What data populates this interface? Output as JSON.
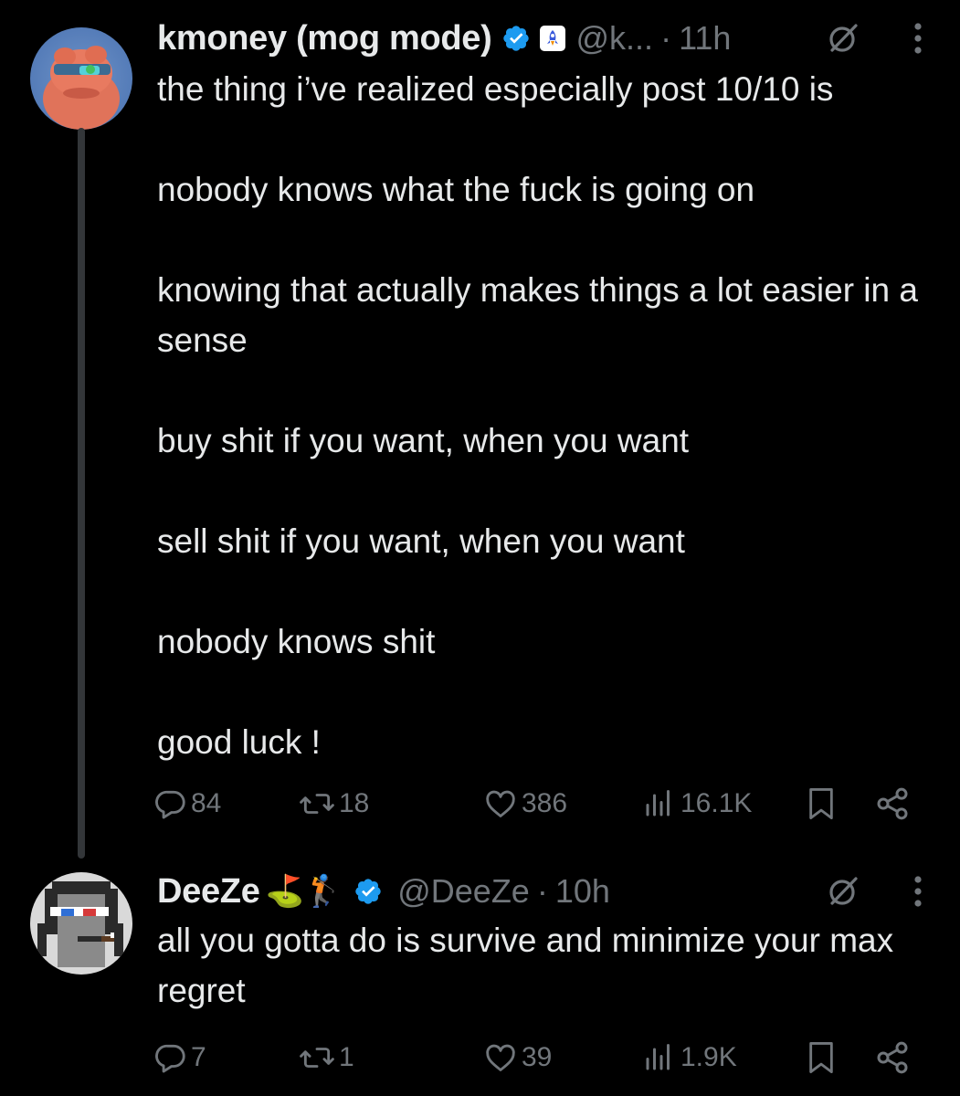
{
  "tweets": [
    {
      "name": "kmoney (mog mode)",
      "handle": "@k...",
      "separator": "·",
      "time": "11h",
      "verified": true,
      "avatar": "orange-pepe-frog-avatar-with-sunglasses",
      "affiliate_icon": "spaceship-icon",
      "paragraphs": [
        "the thing i’ve realized especially post 10/10 is",
        "nobody knows what the fuck is going on",
        "knowing that actually makes things a lot easier in a sense",
        "buy shit if you want, when you want",
        "sell shit if you want, when you want",
        "nobody knows shit",
        "good luck !"
      ],
      "stats": {
        "replies": "84",
        "reposts": "18",
        "likes": "386",
        "views": "16.1K"
      }
    },
    {
      "name": "DeeZe",
      "name_emojis": "⛳🏌",
      "handle": "@DeeZe",
      "separator": "·",
      "time": "10h",
      "verified": true,
      "avatar": "pixel-art-punk-avatar-with-3d-glasses",
      "paragraphs": [
        "all you gotta do is survive and minimize your max regret"
      ],
      "stats": {
        "replies": "7",
        "reposts": "1",
        "likes": "39",
        "views": "1.9K"
      }
    }
  ],
  "colors": {
    "background": "#000000",
    "text": "#e7e9ea",
    "muted": "#71767b",
    "verified": "#1d9bf0",
    "thread_line": "#333639"
  }
}
